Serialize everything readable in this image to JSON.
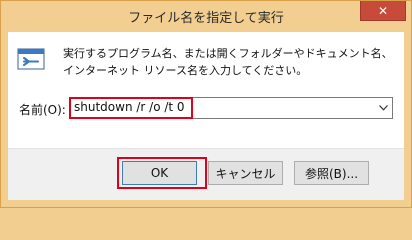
{
  "window": {
    "title": "ファイル名を指定して実行",
    "close_glyph": "✕"
  },
  "dialog": {
    "description": "実行するプログラム名、または開くフォルダーやドキュメント名、インターネット リソース名を入力してください。",
    "open_label": "名前(O):",
    "input_value": "shutdown /r /o /t 0",
    "dropdown_glyph": "⌄"
  },
  "buttons": {
    "ok": "OK",
    "cancel": "キャンセル",
    "browse": "参照(B)..."
  },
  "icons": {
    "run": "run-dialog-icon",
    "close": "close-icon",
    "dropdown": "chevron-down-icon"
  },
  "colors": {
    "window_frame": "#f2cf91",
    "close_button": "#c74b3b",
    "highlight": "#e0001b",
    "client_bg": "#ffffff",
    "footer_bg": "#f0f0f0"
  }
}
